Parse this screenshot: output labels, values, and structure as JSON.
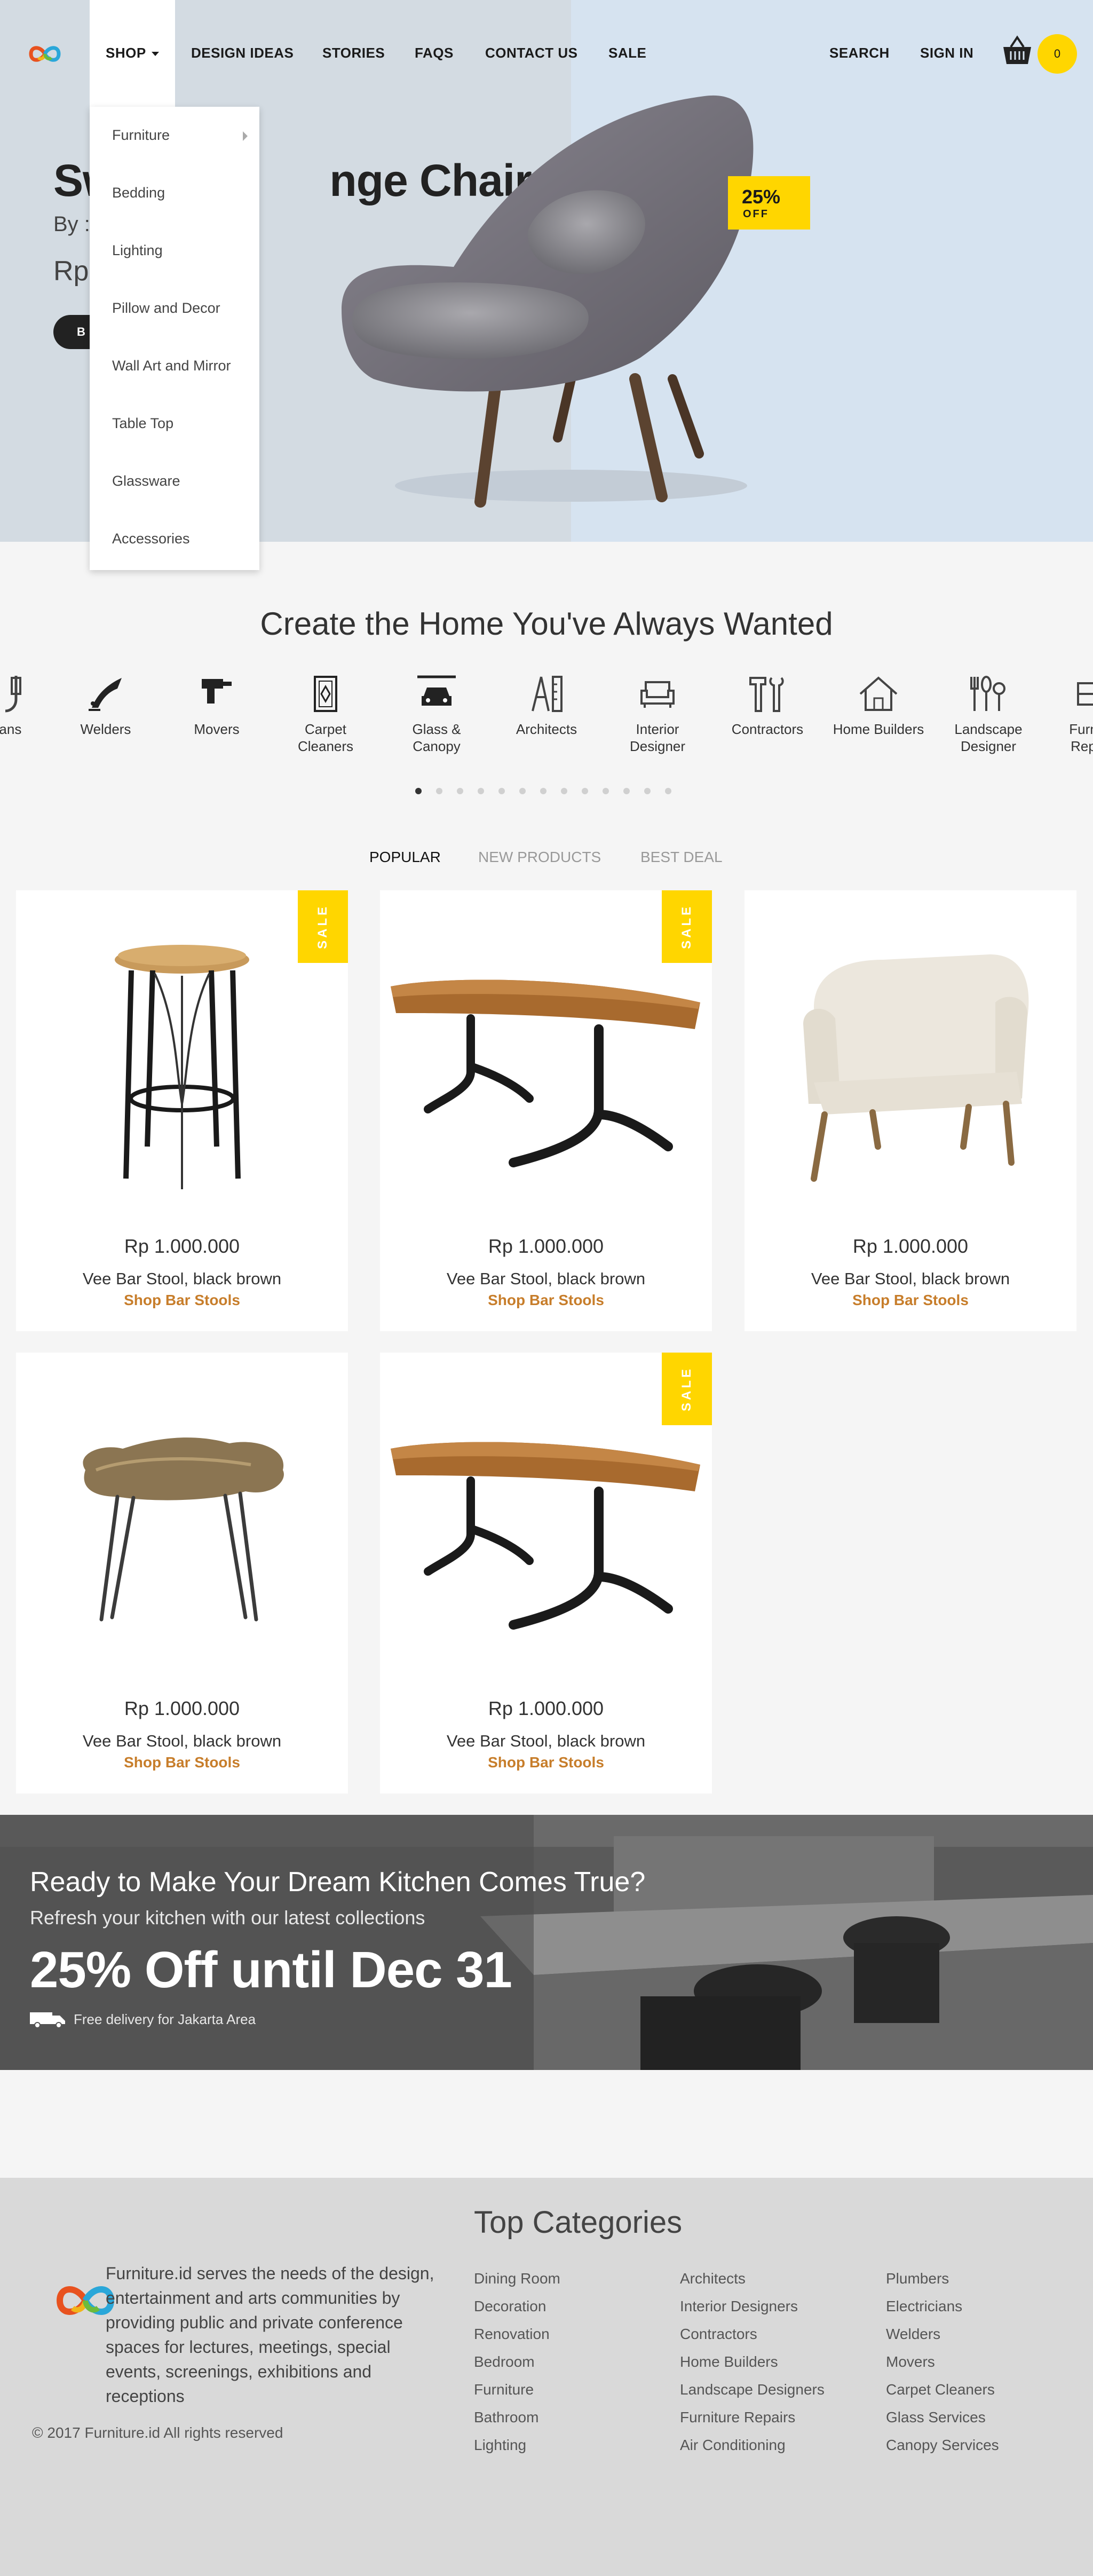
{
  "nav": {
    "shop": "SHOP",
    "design_ideas": "DESIGN IDEAS",
    "stories": "STORIES",
    "faqs": "FAQS",
    "contact_us": "CONTACT US",
    "sale": "SALE",
    "search": "SEARCH",
    "sign_in": "SIGN IN",
    "cart_count": "0"
  },
  "shop_menu": [
    "Furniture",
    "Bedding",
    "Lighting",
    "Pillow and Decor",
    "Wall Art and Mirror",
    "Table Top",
    "Glassware",
    "Accessories"
  ],
  "hero": {
    "title_start": "Sw",
    "title_end": "nge Chair",
    "by": "By :",
    "price": "Rp",
    "button": "B",
    "badge_pct": "25%",
    "badge_off": "OFF"
  },
  "services": {
    "title": "Create the Home You've Always Wanted",
    "items": [
      {
        "label": "cians",
        "icon": "electrician-icon"
      },
      {
        "label": "Welders",
        "icon": "welder-icon"
      },
      {
        "label": "Movers",
        "icon": "drill-icon"
      },
      {
        "label": "Carpet\nCleaners",
        "icon": "carpet-icon"
      },
      {
        "label": "Glass &\nCanopy",
        "icon": "car-canopy-icon"
      },
      {
        "label": "Architects",
        "icon": "compass-ruler-icon"
      },
      {
        "label": "Interior\nDesigner",
        "icon": "sofa-icon"
      },
      {
        "label": "Contractors",
        "icon": "tools-icon"
      },
      {
        "label": "Home Builders",
        "icon": "house-icon"
      },
      {
        "label": "Landscape\nDesigner",
        "icon": "garden-tools-icon"
      },
      {
        "label": "Furn\nRep",
        "icon": "furniture-repair-icon"
      }
    ],
    "dots": 13,
    "active_dot": 0
  },
  "tabs": [
    "POPULAR",
    "NEW PRODUCTS",
    "BEST DEAL"
  ],
  "products": [
    {
      "price": "Rp 1.000.000",
      "name": "Vee Bar Stool, black brown",
      "link": "Shop Bar Stools",
      "sale": "SALE",
      "image": "bar-stool"
    },
    {
      "price": "Rp 1.000.000",
      "name": "Vee Bar Stool, black brown",
      "link": "Shop Bar Stools",
      "sale": "SALE",
      "image": "wood-table"
    },
    {
      "price": "Rp 1.000.000",
      "name": "Vee Bar Stool, black brown",
      "link": "Shop Bar Stools",
      "sale": "",
      "image": "armchair"
    },
    {
      "price": "Rp 1.000.000",
      "name": "Vee Bar Stool, black brown",
      "link": "Shop Bar Stools",
      "sale": "",
      "image": "side-table"
    },
    {
      "price": "Rp 1.000.000",
      "name": "Vee Bar Stool, black brown",
      "link": "Shop Bar Stools",
      "sale": "SALE",
      "image": "wood-table"
    }
  ],
  "banner": {
    "heading": "Ready to Make Your Dream Kitchen Comes True?",
    "sub": "Refresh your kitchen with our latest collections",
    "big": "25% Off until Dec 31",
    "delivery": "Free delivery for Jakarta Area"
  },
  "footer": {
    "title": "Top Categories",
    "description": "Furniture.id serves the needs of the design, entertainment and arts communities by providing public and private conference spaces for lectures, meetings, special events, screenings, exhibitions and receptions",
    "copyright": "© 2017 Furniture.id All rights reserved",
    "col1": [
      "Dining Room",
      "Decoration",
      "Renovation",
      "Bedroom",
      "Furniture",
      "Bathroom",
      "Lighting"
    ],
    "col2": [
      "Architects",
      "Interior Designers",
      "Contractors",
      "Home Builders",
      "Landscape Designers",
      "Furniture Repairs",
      "Air Conditioning"
    ],
    "col3": [
      "Plumbers",
      "Electricians",
      "Welders",
      "Movers",
      "Carpet Cleaners",
      "Glass Services",
      "Canopy Services"
    ]
  },
  "colors": {
    "accent_yellow": "#ffd600",
    "link_orange": "#c77d2a",
    "hero_left": "#d3dbe2",
    "hero_right": "#d6e3f0"
  }
}
